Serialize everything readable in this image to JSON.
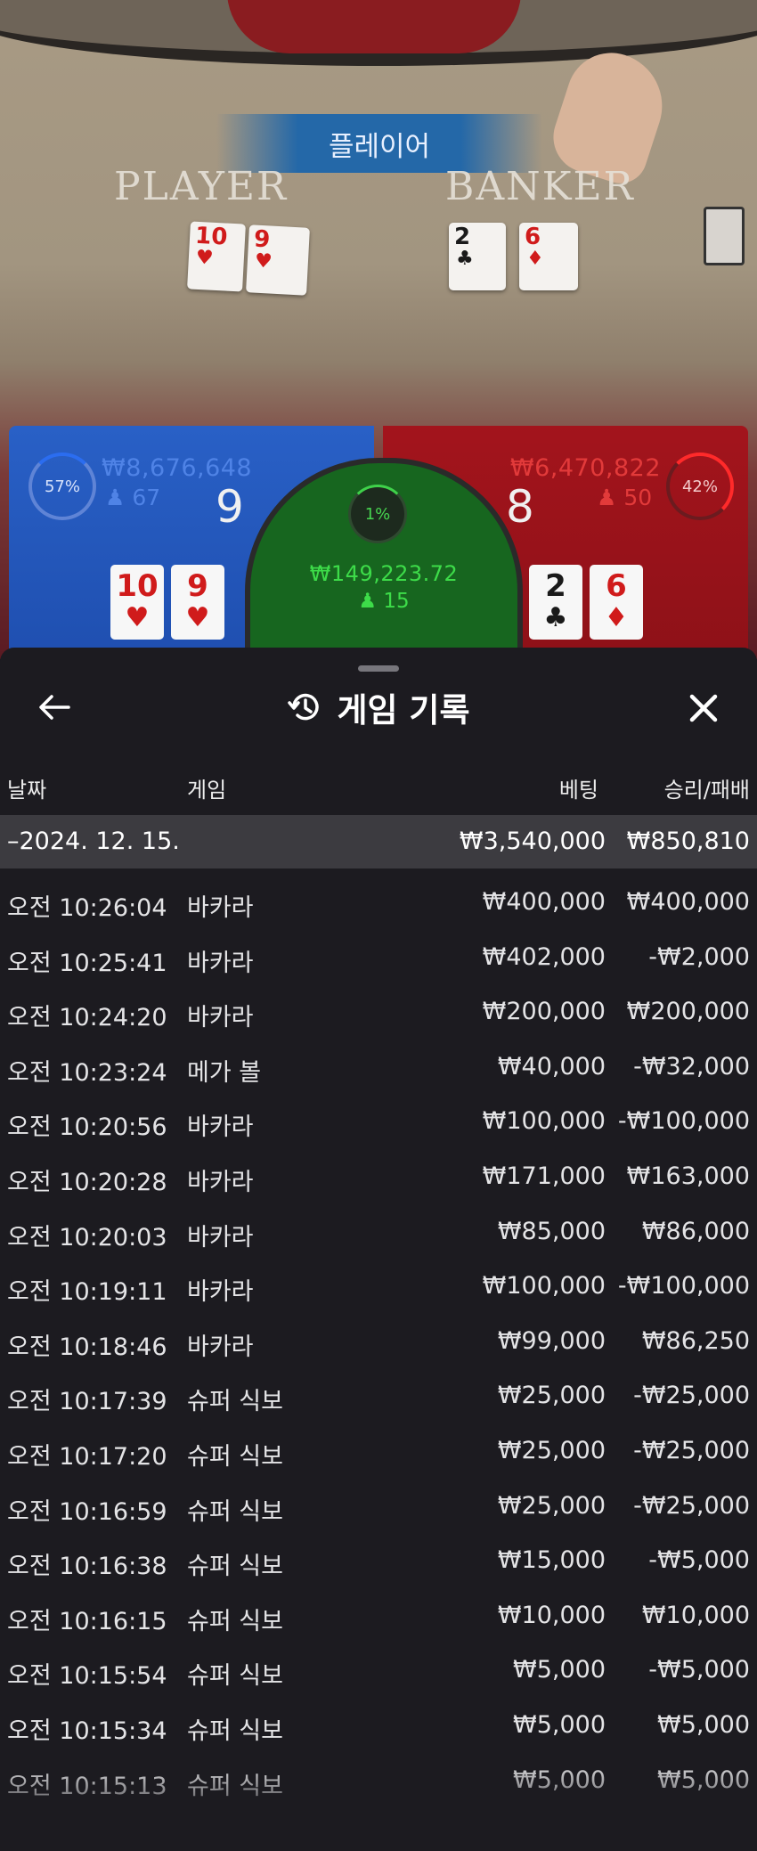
{
  "game": {
    "result_banner": "플레이어",
    "player_title": "PLAYER",
    "banker_title": "BANKER",
    "table_player_cards": [
      {
        "rank": "10",
        "suit": "♥"
      },
      {
        "rank": "9",
        "suit": "♥"
      }
    ],
    "table_banker_cards": [
      {
        "rank": "2",
        "suit": "♣"
      },
      {
        "rank": "6",
        "suit": "♦"
      }
    ]
  },
  "board": {
    "player": {
      "percent": "57%",
      "percent_value": 57,
      "amount": "₩8,676,648",
      "count": "67",
      "score": "9",
      "cards": [
        {
          "rank": "10",
          "suit": "♥"
        },
        {
          "rank": "9",
          "suit": "♥"
        }
      ]
    },
    "tie": {
      "percent": "1%",
      "percent_value": 1,
      "amount": "₩149,223.72",
      "count": "15"
    },
    "banker": {
      "percent": "42%",
      "percent_value": 42,
      "amount": "₩6,470,822",
      "count": "50",
      "score": "8",
      "cards": [
        {
          "rank": "2",
          "suit": "♣"
        },
        {
          "rank": "6",
          "suit": "♦"
        }
      ]
    },
    "colors": {
      "player": "#2960c6",
      "banker": "#a3141c",
      "tie": "#17661f"
    }
  },
  "history": {
    "title": "게임 기록",
    "icons": {
      "back": "arrow-left-icon",
      "title": "history-icon",
      "close": "close-icon"
    },
    "columns": {
      "date": "날짜",
      "game": "게임",
      "bet": "베팅",
      "result": "승리/패배"
    },
    "day": {
      "date": "–2024. 12. 15.",
      "bet": "₩3,540,000",
      "result": "₩850,810"
    },
    "rows": [
      {
        "time": "오전 10:26:04",
        "game": "바카라",
        "bet": "₩400,000",
        "result": "₩400,000"
      },
      {
        "time": "오전 10:25:41",
        "game": "바카라",
        "bet": "₩402,000",
        "result": "-₩2,000"
      },
      {
        "time": "오전 10:24:20",
        "game": "바카라",
        "bet": "₩200,000",
        "result": "₩200,000"
      },
      {
        "time": "오전 10:23:24",
        "game": "메가 볼",
        "bet": "₩40,000",
        "result": "-₩32,000"
      },
      {
        "time": "오전 10:20:56",
        "game": "바카라",
        "bet": "₩100,000",
        "result": "-₩100,000"
      },
      {
        "time": "오전 10:20:28",
        "game": "바카라",
        "bet": "₩171,000",
        "result": "₩163,000"
      },
      {
        "time": "오전 10:20:03",
        "game": "바카라",
        "bet": "₩85,000",
        "result": "₩86,000"
      },
      {
        "time": "오전 10:19:11",
        "game": "바카라",
        "bet": "₩100,000",
        "result": "-₩100,000"
      },
      {
        "time": "오전 10:18:46",
        "game": "바카라",
        "bet": "₩99,000",
        "result": "₩86,250"
      },
      {
        "time": "오전 10:17:39",
        "game": "슈퍼 식보",
        "bet": "₩25,000",
        "result": "-₩25,000"
      },
      {
        "time": "오전 10:17:20",
        "game": "슈퍼 식보",
        "bet": "₩25,000",
        "result": "-₩25,000"
      },
      {
        "time": "오전 10:16:59",
        "game": "슈퍼 식보",
        "bet": "₩25,000",
        "result": "-₩25,000"
      },
      {
        "time": "오전 10:16:38",
        "game": "슈퍼 식보",
        "bet": "₩15,000",
        "result": "-₩5,000"
      },
      {
        "time": "오전 10:16:15",
        "game": "슈퍼 식보",
        "bet": "₩10,000",
        "result": "₩10,000"
      },
      {
        "time": "오전 10:15:54",
        "game": "슈퍼 식보",
        "bet": "₩5,000",
        "result": "-₩5,000"
      },
      {
        "time": "오전 10:15:34",
        "game": "슈퍼 식보",
        "bet": "₩5,000",
        "result": "₩5,000"
      },
      {
        "time": "오전 10:15:13",
        "game": "슈퍼 식보",
        "bet": "₩5,000",
        "result": "₩5,000"
      }
    ]
  }
}
